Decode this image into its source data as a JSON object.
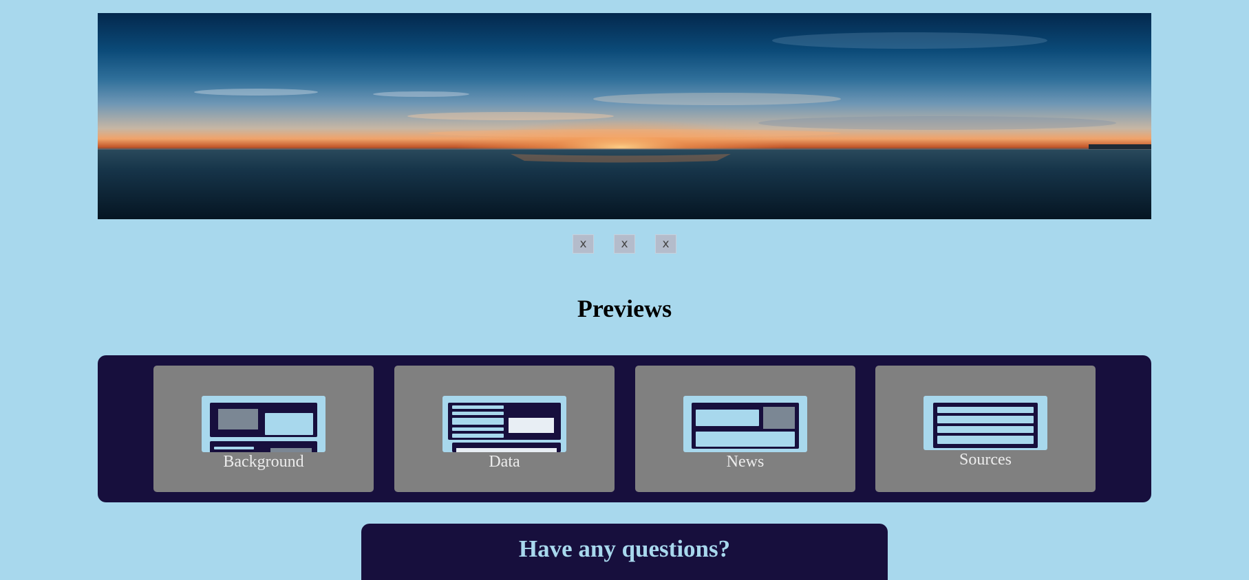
{
  "hero": {
    "alt": "Ocean sunset panorama"
  },
  "slider": {
    "thumbs": [
      {
        "icon": "broken-image-icon",
        "glyph": "x"
      },
      {
        "icon": "broken-image-icon",
        "glyph": "x"
      },
      {
        "icon": "broken-image-icon",
        "glyph": "x"
      }
    ]
  },
  "previews": {
    "title": "Previews",
    "cards": [
      {
        "label": "Background"
      },
      {
        "label": "Data"
      },
      {
        "label": "News"
      },
      {
        "label": "Sources"
      }
    ]
  },
  "questions": {
    "title": "Have any questions?"
  },
  "colors": {
    "page_bg": "#a8d8ed",
    "panel_bg": "#170f3d",
    "card_bg": "#808080",
    "card_label": "#ececec",
    "questions_title": "#a8d8ed"
  }
}
